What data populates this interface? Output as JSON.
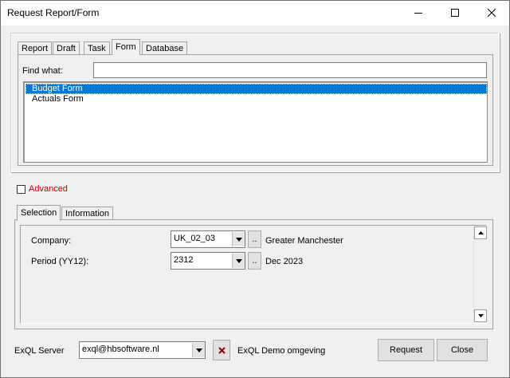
{
  "window": {
    "title": "Request Report/Form"
  },
  "top_tabs": {
    "report": "Report",
    "draft": "Draft",
    "task": "Task",
    "form": "Form",
    "database": "Database",
    "active": "Form"
  },
  "find": {
    "label": "Find what:",
    "value": ""
  },
  "forms_list": {
    "items": [
      "Budget Form",
      "Actuals Form"
    ],
    "selected": "Budget Form"
  },
  "advanced": {
    "label": "Advanced",
    "checked": false
  },
  "lower_tabs": {
    "selection": "Selection",
    "information": "Information",
    "active": "Selection"
  },
  "selection": {
    "company": {
      "label": "Company:",
      "value": "UK_02_03",
      "browse": "..",
      "description": "Greater Manchester"
    },
    "period": {
      "label": "Period (YY12):",
      "value": "2312",
      "browse": "..",
      "description": "Dec 2023"
    }
  },
  "footer": {
    "server_label": "ExQL Server",
    "server_value": "exql@hbsoftware.nl",
    "server_description": "ExQL Demo omgeving",
    "request_button": "Request",
    "close_button": "Close"
  },
  "colors": {
    "selection_blue": "#0078d7",
    "advanced_red": "#c00000",
    "disconnect_red": "#8b0000"
  }
}
